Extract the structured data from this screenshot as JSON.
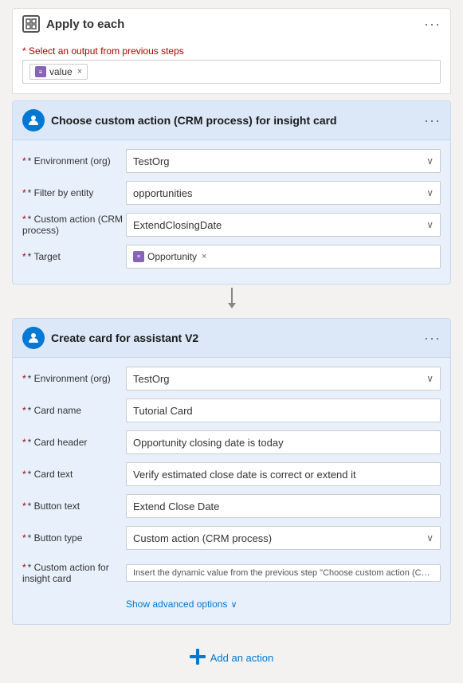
{
  "applyHeader": {
    "title": "Apply to each",
    "dotsLabel": "···"
  },
  "selectOutput": {
    "label": "* Select an output from previous steps",
    "tag": {
      "text": "value",
      "closeChar": "×"
    }
  },
  "actionBlock1": {
    "title": "Choose custom action (CRM process) for insight card",
    "dotsLabel": "···",
    "fields": [
      {
        "label": "* Environment (org)",
        "value": "TestOrg",
        "type": "dropdown"
      },
      {
        "label": "* Filter by entity",
        "value": "opportunities",
        "type": "dropdown"
      },
      {
        "label": "* Custom action (CRM process)",
        "value": "ExtendClosingDate",
        "type": "dropdown"
      },
      {
        "label": "* Target",
        "value": "Opportunity",
        "type": "tag"
      }
    ]
  },
  "actionBlock2": {
    "title": "Create card for assistant V2",
    "dotsLabel": "···",
    "fields": [
      {
        "label": "* Environment (org)",
        "value": "TestOrg",
        "type": "dropdown"
      },
      {
        "label": "* Card name",
        "value": "Tutorial Card",
        "type": "text"
      },
      {
        "label": "* Card header",
        "value": "Opportunity closing date is today",
        "type": "text"
      },
      {
        "label": "* Card text",
        "value": "Verify estimated close date is correct or extend it",
        "type": "text"
      },
      {
        "label": "* Button text",
        "value": "Extend Close Date",
        "type": "text"
      },
      {
        "label": "* Button type",
        "value": "Custom action (CRM process)",
        "type": "dropdown"
      },
      {
        "label": "* Custom action for insight card",
        "value": "Insert the dynamic value from the previous step \"Choose custom action (CRM p",
        "type": "placeholder"
      }
    ],
    "advancedOptions": "Show advanced options"
  },
  "addAction": {
    "label": "Add an action"
  }
}
